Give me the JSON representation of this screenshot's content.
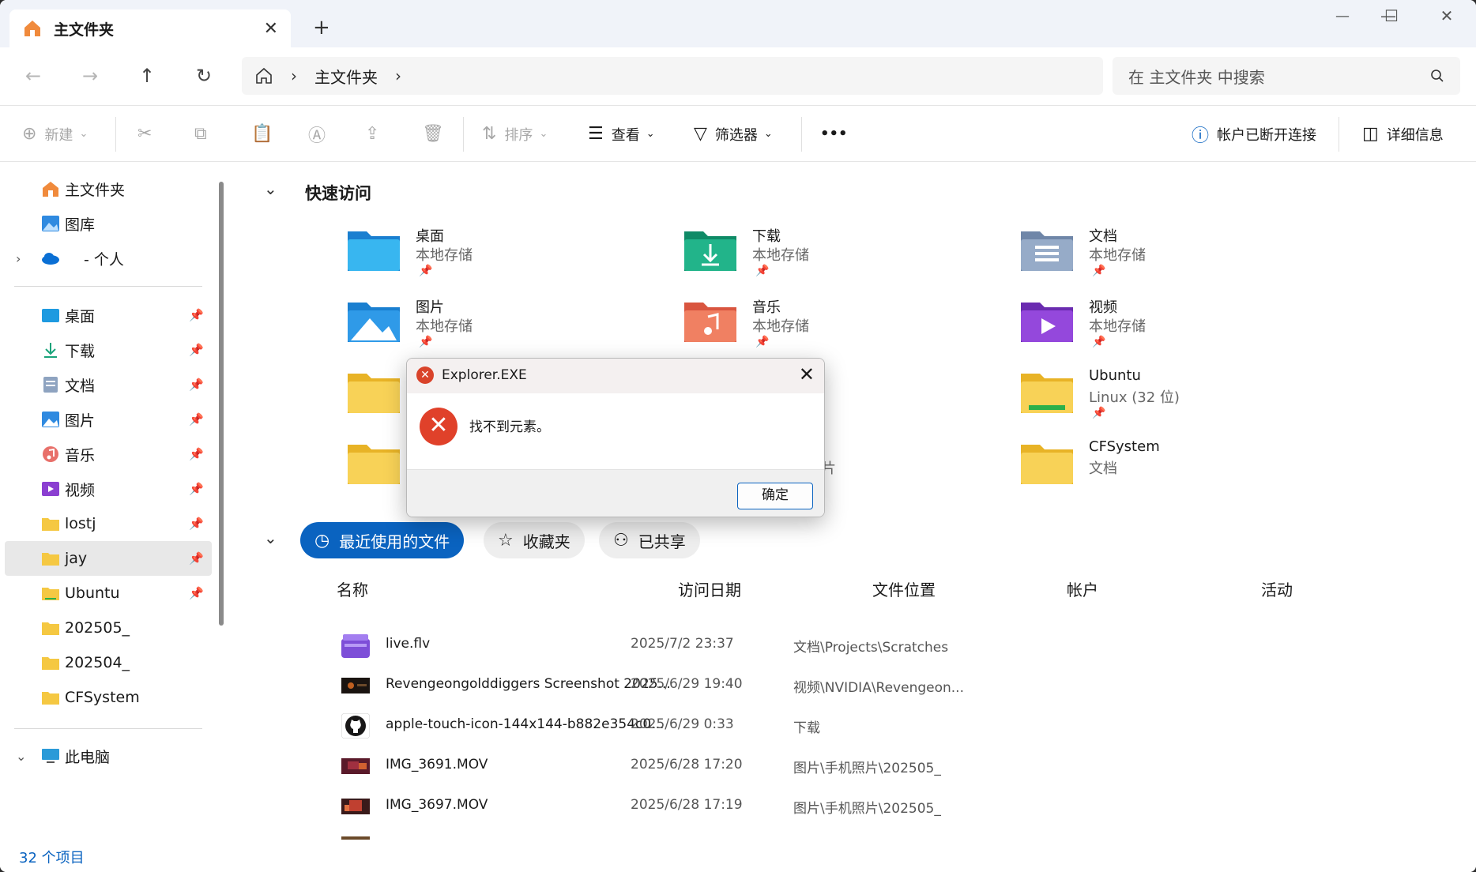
{
  "window": {
    "tab_title": "主文件夹",
    "new_tab": "+",
    "minimize": "—",
    "maximize": "☐",
    "close": "✕"
  },
  "nav": {
    "back": "←",
    "forward": "→",
    "up": "↑",
    "refresh": "↻",
    "breadcrumb": "主文件夹",
    "search_placeholder": "在 主文件夹 中搜索"
  },
  "toolbar": {
    "new_label": "新建",
    "sort_label": "排序",
    "view_label": "查看",
    "filter_label": "筛选器",
    "more_label": "•••",
    "account_status": "帐户已断开连接",
    "details_label": "详细信息"
  },
  "sidebar": {
    "top_items": [
      {
        "label": "主文件夹"
      },
      {
        "label": "图库"
      },
      {
        "label": "- 个人"
      }
    ],
    "pinned_items": [
      {
        "label": "桌面"
      },
      {
        "label": "下载"
      },
      {
        "label": "文档"
      },
      {
        "label": "图片"
      },
      {
        "label": "音乐"
      },
      {
        "label": "视频"
      },
      {
        "label": "lostj"
      },
      {
        "label": "jay"
      },
      {
        "label": "Ubuntu"
      },
      {
        "label": "202505_"
      },
      {
        "label": "202504_"
      },
      {
        "label": "CFSystem"
      }
    ],
    "this_pc": "此电脑"
  },
  "quick_access": {
    "title": "快速访问",
    "items": [
      {
        "name": "桌面",
        "sub": "本地存储"
      },
      {
        "name": "下载",
        "sub": "本地存储"
      },
      {
        "name": "文档",
        "sub": "本地存储"
      },
      {
        "name": "图片",
        "sub": "本地存储"
      },
      {
        "name": "音乐",
        "sub": "本地存储"
      },
      {
        "name": "视频",
        "sub": "本地存储"
      },
      {
        "name": "Ubuntu",
        "sub": "Linux (32 位)"
      },
      {
        "name": "CFSystem",
        "sub": "文档"
      }
    ],
    "hidden_partial_text": "片"
  },
  "recent": {
    "tabs": [
      {
        "label": "最近使用的文件"
      },
      {
        "label": "收藏夹"
      },
      {
        "label": "已共享"
      }
    ],
    "columns": [
      "名称",
      "访问日期",
      "文件位置",
      "帐户",
      "活动"
    ],
    "rows": [
      {
        "name": "live.flv",
        "date": "2025/7/2 23:37",
        "location": "文档\\Projects\\Scratches"
      },
      {
        "name": "Revengeongolddiggers Screenshot 2025...",
        "date": "2025/6/29 19:40",
        "location": "视频\\NVIDIA\\Revengeon..."
      },
      {
        "name": "apple-touch-icon-144x144-b882e354c0...",
        "date": "2025/6/29 0:33",
        "location": "下载"
      },
      {
        "name": "IMG_3691.MOV",
        "date": "2025/6/28 17:20",
        "location": "图片\\手机照片\\202505_"
      },
      {
        "name": "IMG_3697.MOV",
        "date": "2025/6/28 17:19",
        "location": "图片\\手机照片\\202505_"
      }
    ]
  },
  "status": {
    "item_count": "32 个项目"
  },
  "dialog": {
    "title": "Explorer.EXE",
    "message": "找不到元素。",
    "ok_label": "确定"
  },
  "colors": {
    "accent": "#0a63c0",
    "error": "#e0412a",
    "folder": "#f5c842"
  }
}
